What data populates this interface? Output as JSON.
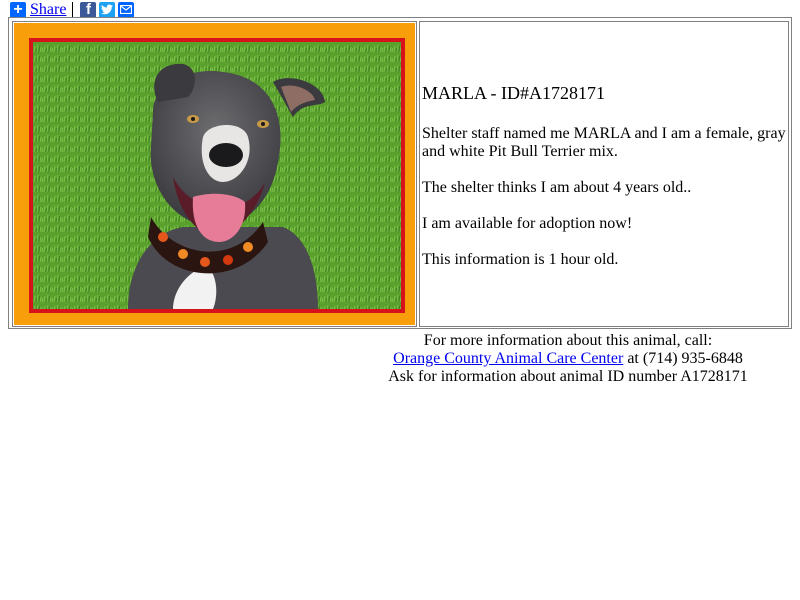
{
  "sharebar": {
    "plus_icon": "plus-icon",
    "share_label": "Share",
    "icons": [
      "facebook-icon",
      "twitter-icon",
      "email-icon"
    ]
  },
  "animal": {
    "title": "MARLA - ID#A1728171",
    "description": "Shelter staff named me MARLA and I am a female, gray and white Pit Bull Terrier mix.",
    "age_text": "The shelter thinks I am about 4 years old..",
    "availability": "I am available for adoption now!",
    "freshness": "This information is 1 hour old."
  },
  "contact": {
    "line1": "For more information about this animal, call:",
    "center_name": "Orange County Animal Care Center",
    "phone_text": " at (714) 935-6848",
    "line3": "Ask for information about animal ID number A1728171"
  },
  "colors": {
    "frame_orange": "#f79e0a",
    "frame_red": "#d7121b",
    "link_blue": "#0000ee",
    "share_blue": "#0166ff"
  }
}
